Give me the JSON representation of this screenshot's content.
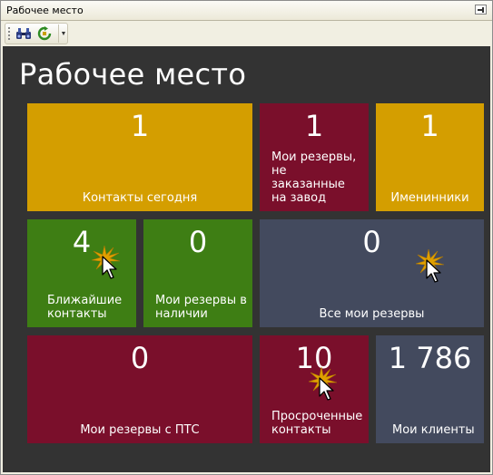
{
  "window": {
    "title": "Рабочее место"
  },
  "toolbar": {
    "buttons": [
      {
        "icon": "binoculars-icon"
      },
      {
        "icon": "refresh-icon"
      }
    ]
  },
  "page": {
    "heading": "Рабочее место"
  },
  "colors": {
    "gold": "#d49e00",
    "crimson": "#7a0f2b",
    "green": "#3e7e14",
    "slate": "#434a5e",
    "background": "#333333"
  },
  "tiles": {
    "contacts_today": {
      "count": "1",
      "label": "Контакты сегодня"
    },
    "my_reserves_not_ordered": {
      "count": "1",
      "label": "Мои резервы, не заказанные на завод"
    },
    "birthdays": {
      "count": "1",
      "label": "Именинники"
    },
    "nearest_contacts": {
      "count": "4",
      "label": "Ближайшие контакты"
    },
    "my_reserves_in_stock": {
      "count": "0",
      "label": "Мои резервы в наличии"
    },
    "all_my_reserves": {
      "count": "0",
      "label": "Все мои резервы"
    },
    "my_reserves_with_pts": {
      "count": "0",
      "label": "Мои резервы с ПТС"
    },
    "overdue_contacts": {
      "count": "10",
      "label": "Просроченные контакты"
    },
    "my_clients": {
      "count": "1 786",
      "label": "Мои клиенты"
    }
  }
}
